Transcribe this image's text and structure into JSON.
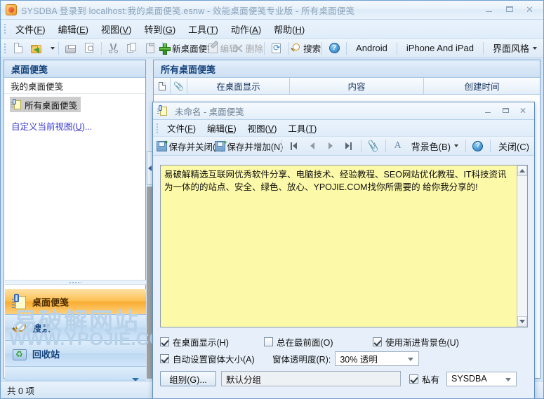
{
  "window": {
    "title": "SYSDBA 登录到 localhost:我的桌面便笺.esnw - 效能桌面便笺专业版 - 所有桌面便笺",
    "icon": "app-icon",
    "minimize": "–",
    "maximize": "❐",
    "close": "✕"
  },
  "menubar": {
    "items": [
      {
        "label": "文件(F)",
        "mnemonic": "F"
      },
      {
        "label": "编辑(E)",
        "mnemonic": "E"
      },
      {
        "label": "视图(V)",
        "mnemonic": "V"
      },
      {
        "label": "转到(G)",
        "mnemonic": "G"
      },
      {
        "label": "工具(T)",
        "mnemonic": "T"
      },
      {
        "label": "动作(A)",
        "mnemonic": "A"
      },
      {
        "label": "帮助(H)",
        "mnemonic": "H"
      }
    ]
  },
  "toolbar": {
    "new_icon": "new-page-icon",
    "open_icon": "open-folder-icon",
    "open_dropdown_icon": "chevron-down-icon",
    "print_icon": "print-icon",
    "print_preview_icon": "print-preview-icon",
    "cut_icon": "cut-icon",
    "copy_icon": "copy-icon",
    "paste_icon": "paste-icon",
    "new_note_icon": "plus-icon",
    "new_note_label": "新桌面便笺",
    "edit_icon": "edit-icon",
    "edit_label": "编辑",
    "delete_icon": "delete-x-icon",
    "delete_label": "删除",
    "refresh_icon": "refresh-icon",
    "search_icon": "search-icon",
    "search_label": "搜索",
    "help_icon": "help-icon",
    "android_label": "Android",
    "iphone_label": "iPhone And iPad",
    "skin_label": "界面风格"
  },
  "sidebar": {
    "header": "桌面便笺",
    "group_label": "我的桌面便笺",
    "tree": [
      {
        "label": "所有桌面便笺",
        "icon": "note-icon",
        "selected": true
      }
    ],
    "customize_link": "自定义当前视图(U)...",
    "nav_buttons": [
      {
        "label": "桌面便笺",
        "icon": "note-icon-large",
        "active": true
      },
      {
        "label": "搜索",
        "icon": "search-icon-large",
        "active": false
      },
      {
        "label": "回收站",
        "icon": "recycle-bin-icon",
        "active": false
      }
    ],
    "more_icon": "chevron-down-icon"
  },
  "listpane": {
    "header": "所有桌面便笺",
    "columns": [
      {
        "label": "",
        "icon": "page-icon"
      },
      {
        "label": "",
        "icon": "attachment-icon"
      },
      {
        "label": "在桌面显示"
      },
      {
        "label": "内容"
      },
      {
        "label": "创建时间"
      }
    ],
    "rows": []
  },
  "statusbar": {
    "text": "共 0 项"
  },
  "watermark": {
    "line1": "易破解网站",
    "line2": "WWW.YPOJIE.COM"
  },
  "dialog": {
    "title": "未命名 - 桌面便笺",
    "icon": "note-icon",
    "minimize": "–",
    "maximize": "❐",
    "close": "✕",
    "menubar": [
      {
        "label": "文件(F)"
      },
      {
        "label": "编辑(E)"
      },
      {
        "label": "视图(V)"
      },
      {
        "label": "工具(T)"
      }
    ],
    "toolbar": {
      "save_close_icon": "save-close-icon",
      "save_close_label": "保存并关闭(S)",
      "save_add_icon": "save-add-icon",
      "save_add_label": "保存并增加(N)",
      "first_icon": "first-record-icon",
      "prev_icon": "prev-record-icon",
      "next_icon": "next-record-icon",
      "last_icon": "last-record-icon",
      "attach_icon": "attachment-icon",
      "font_icon": "font-icon",
      "bgcolor_label": "背景色(B)",
      "bgcolor_caret_icon": "chevron-down-icon",
      "help_icon": "help-icon",
      "close_label": "关闭(C)"
    },
    "note": {
      "text": "易破解精选互联网优秀软件分享、电脑技术、经验教程、SEO网站优化教程、IT科技资讯为一体的的站点、安全、绿色、放心、YPOJIE.COM找你所需要的 给你我分享的!",
      "background_color": "#fcf9a8",
      "scroll_up_icon": "scroll-up-icon",
      "scroll_down_icon": "scroll-down-icon"
    },
    "options": {
      "show_on_desktop": {
        "label": "在桌面显示(H)",
        "checked": true
      },
      "always_on_top": {
        "label": "总在最前面(O)",
        "checked": false
      },
      "gradient_bg": {
        "label": "使用渐进背景色(U)",
        "checked": true
      },
      "auto_size": {
        "label": "自动设置窗体大小(A)",
        "checked": true
      },
      "opacity_label": "窗体透明度(R):",
      "opacity_value": "30% 透明",
      "group_button": "组别(G)...",
      "group_value": "默认分组",
      "private": {
        "label": "私有",
        "checked": true
      },
      "user_value": "SYSDBA",
      "dropdown_icon": "chevron-down-icon"
    }
  },
  "colors": {
    "accent": "#2f6fa8",
    "note_yellow": "#fcf9a8",
    "nav_active": "#f8ad31",
    "title_text": "#8ea4bb",
    "watermark": "#b8d2ea"
  }
}
